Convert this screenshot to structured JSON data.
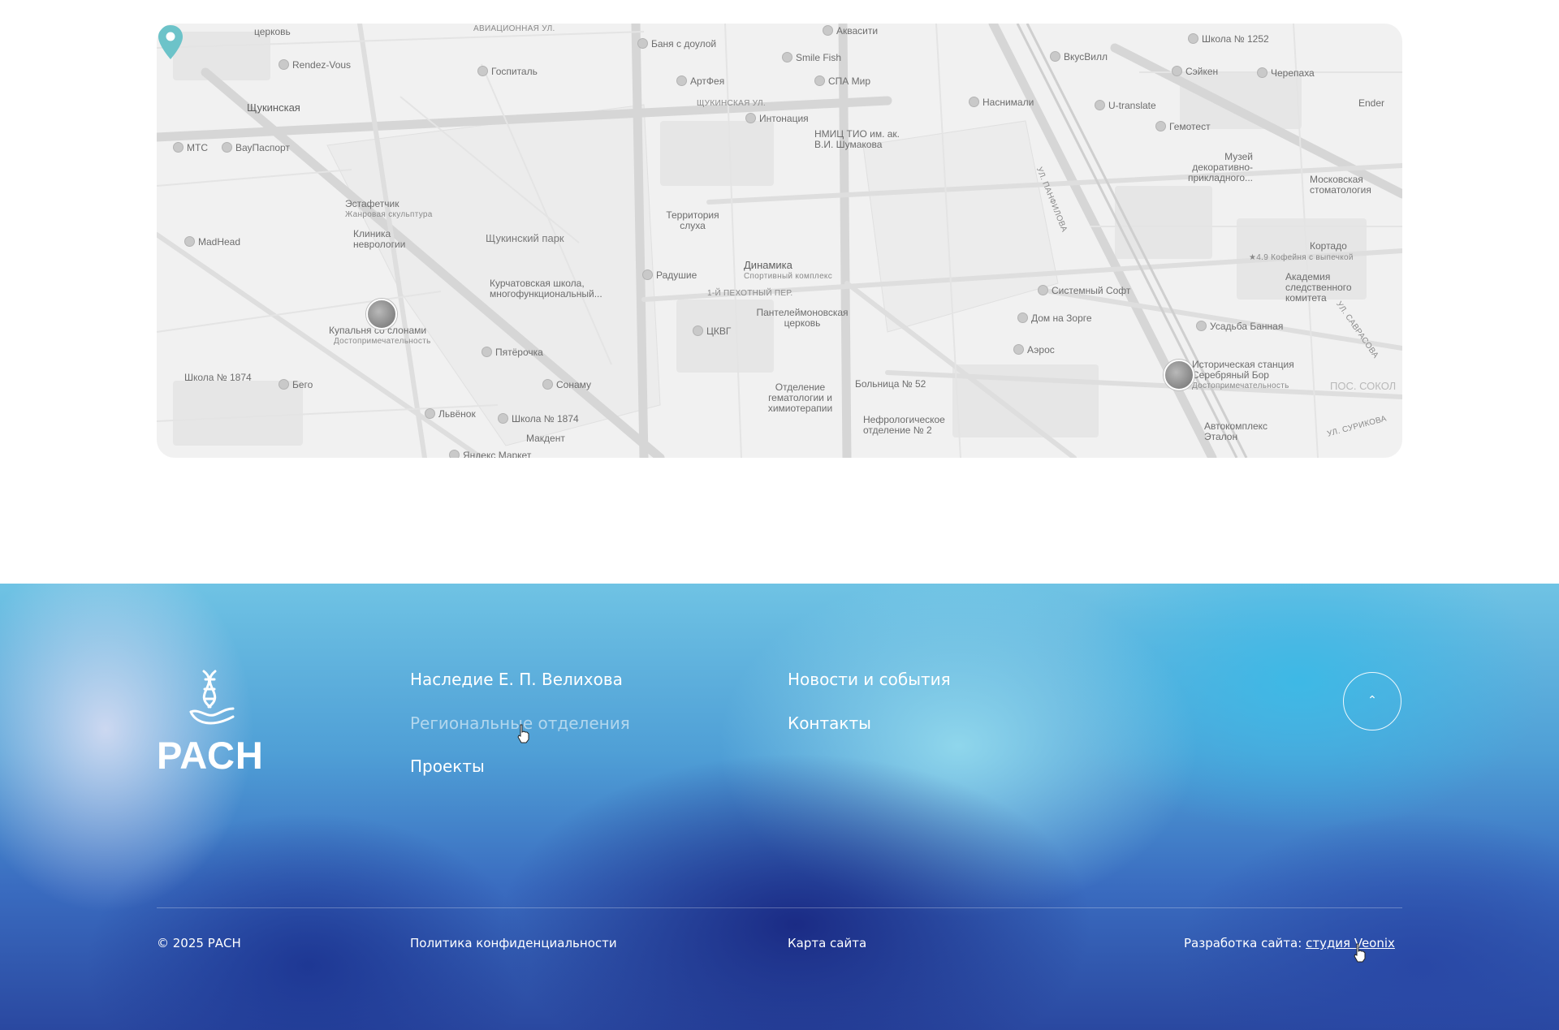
{
  "map": {
    "labels": {
      "shchukinskaya_metro": "Щукинская",
      "rendez_vous": "Rendez-Vous",
      "gospital": "Госпиталь",
      "banya": "Баня с доулой",
      "akvasiti": "Аквасити",
      "smile_fish": "Smile Fish",
      "artfeya": "АртФея",
      "spa_mir": "СПА Мир",
      "vkusvill": "ВкусВилл",
      "sheikin": "Сэйкен",
      "cherepakha": "Черепаха",
      "shkola_1252": "Школа № 1252",
      "nasnimali": "Наснимали",
      "u_translate": "U-translate",
      "gemotest": "Гемотест",
      "intonatsiya": "Интонация",
      "nmits_tio": "НМИЦ ТИО им. ак. В.И. Шумакова",
      "mts": "МТС",
      "vaupasport": "ВауПаспорт",
      "estafetchik": "Эстафетчик",
      "estafetchik_sub": "Жанровая скульптура",
      "madhead": "MadHead",
      "klinika_nevrologii": "Клиника неврологии",
      "shchukinsky_park": "Щукинский парк",
      "territoriya_slukha": "Территория слуха",
      "radushie": "Радушие",
      "dinamika": "Динамика",
      "dinamika_sub": "Спортивный комплекс",
      "kurchatovskaya": "Курчатовская школа, многофункциональный...",
      "kupalnya": "Купальня со слонами",
      "kupalnya_sub": "Достопримечательность",
      "pyaterochka": "Пятёрочка",
      "sonamu": "Сонаму",
      "shkola_1874_left": "Школа № 1874",
      "bego": "Бего",
      "lvenok": "Львёнок",
      "shkola_1874": "Школа № 1874",
      "makdent": "Макдент",
      "yandex_market": "Яндекс Маркет",
      "pantele": "Пантелеймоновская церковь",
      "kvg": "ЦКВГ",
      "sistemny_soft": "Системный Софт",
      "dom_na_zorge": "Дом на Зорге",
      "aeros": "Аэрос",
      "bolnitsa_52": "Больница № 52",
      "otdelenie": "Отделение гематологии и химиотерапии",
      "nefrologicheskoe": "Нефрологическое отделение № 2",
      "muzei": "Музей декоративно-прикладного...",
      "moskovskaya_stom": "Московская стоматология",
      "kortado": "Кортадо",
      "kortado_sub": "★4.9 Кофейня с выпечкой",
      "akademiya": "Академия следственного комитета",
      "usadba": "Усадьба Банная",
      "istoricheskaya": "Историческая станция Серебряный Бор",
      "istoricheskaya_sub": "Достопримечательность",
      "avtokompleks": "Автокомплекс Эталон",
      "pos_sokol": "ПОС. СОКОЛ",
      "ender": "Ender",
      "tserkov": "церковь",
      "st_aviatsionnaya": "АВИАЦИОННАЯ УЛ.",
      "st_shchukinskaya": "ЩУКИНСКАЯ УЛ.",
      "st_pekhotny": "1-Й ПЕХОТНЫЙ ПЕР.",
      "st_panfilova": "УЛ. ПАНФИЛОВА",
      "st_savrasova": "УЛ. САВРАСОВА",
      "st_surikova": "УЛ. СУРИКОВА"
    },
    "pin_color": "#6cc3c9"
  },
  "footer": {
    "logo_text": "РАСН",
    "nav": {
      "legacy": "Наследие Е. П. Велихова",
      "regional": "Региональные отделения",
      "projects": "Проекты",
      "news": "Новости и события",
      "contacts": "Контакты"
    },
    "scroll_top_icon": "chevron-up-icon",
    "copyright": "© 2025 РАСН",
    "privacy": "Политика конфиденциальности",
    "sitemap": "Карта сайта",
    "dev_prefix": "Разработка сайта:",
    "dev_link": "студия Veonix"
  },
  "colors": {
    "footer_text": "#ffffff",
    "map_bg": "#f1f1f1",
    "accent_pin": "#6cc3c9"
  }
}
